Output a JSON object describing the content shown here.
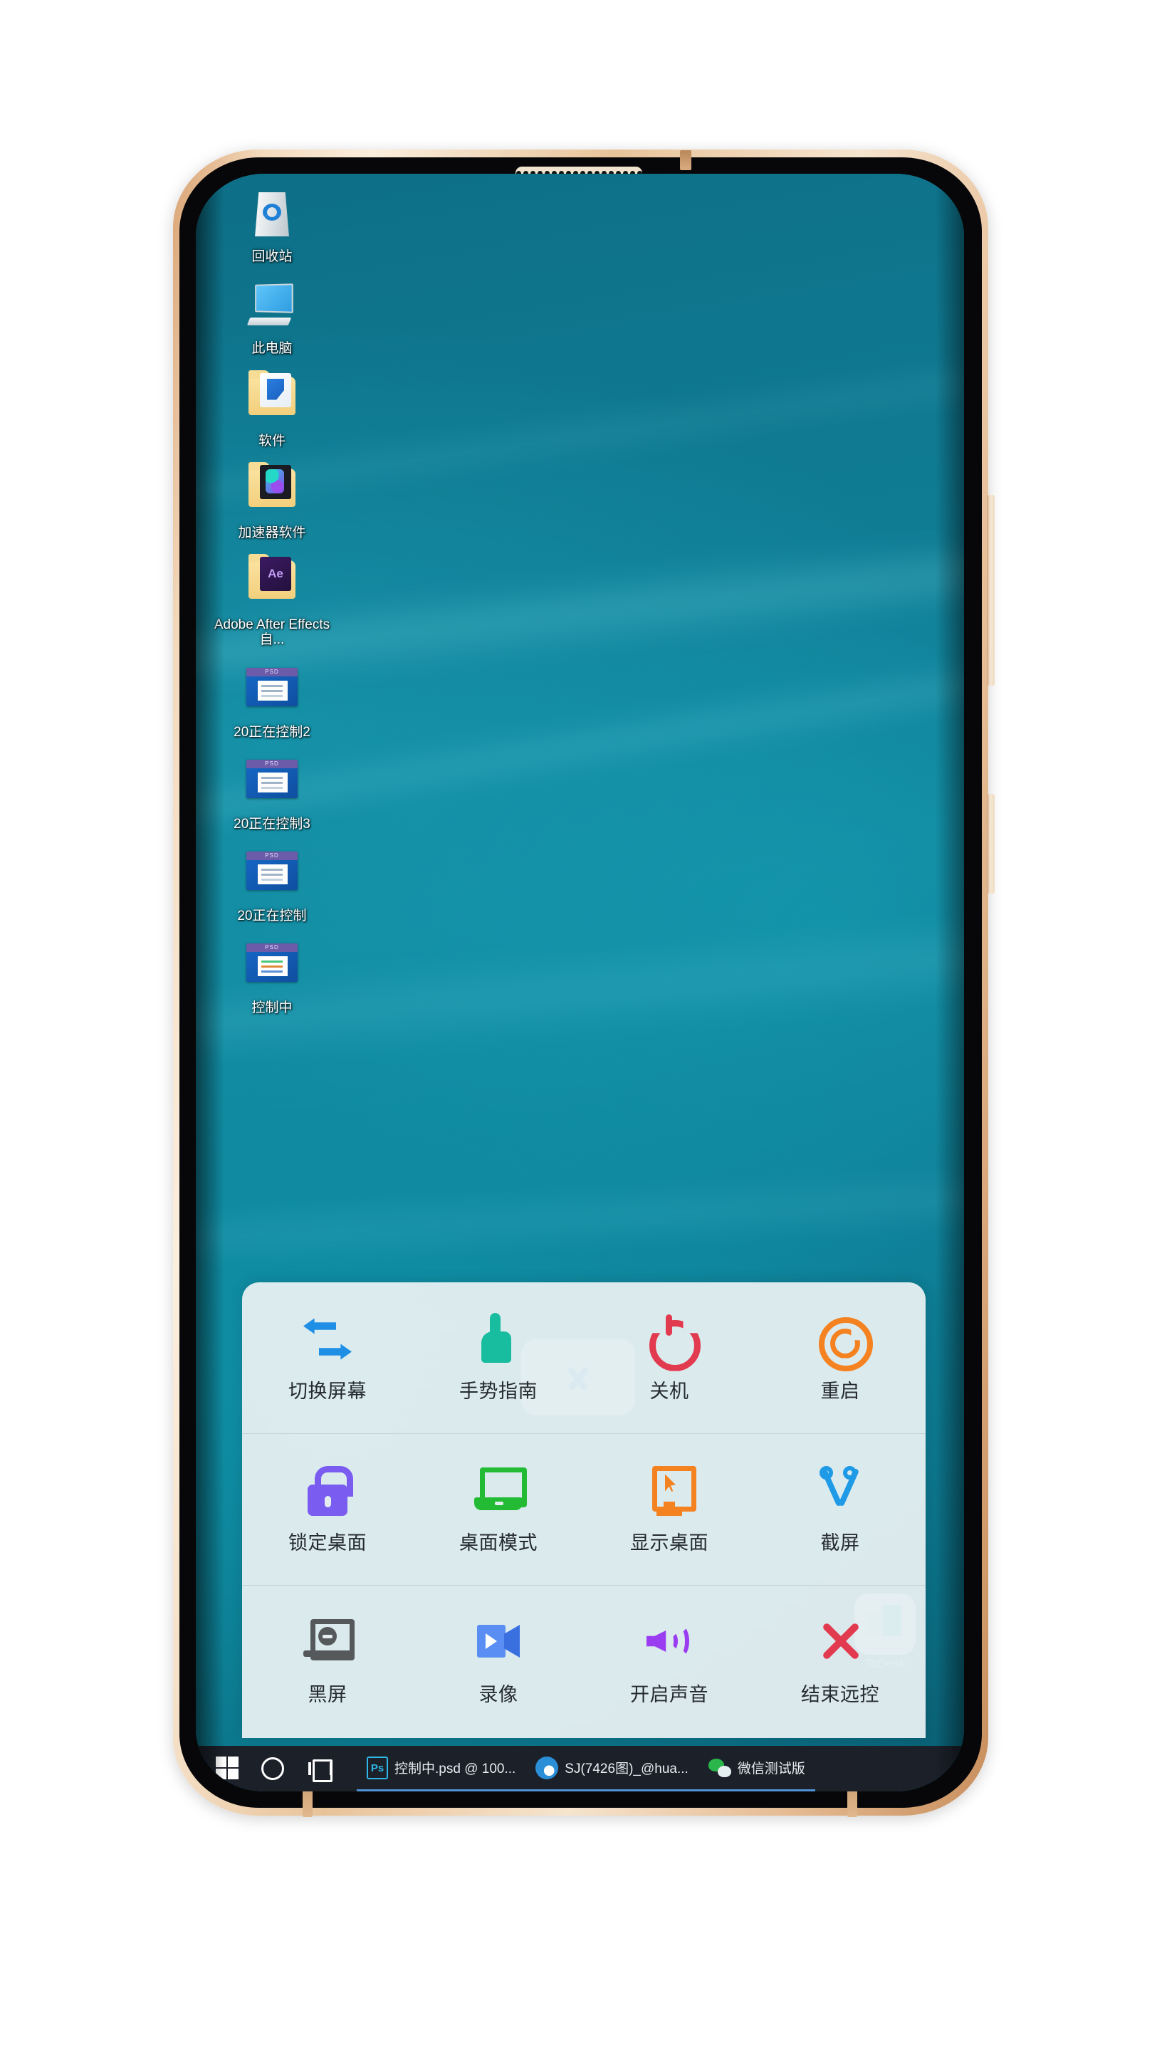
{
  "device": {
    "name": "smartphone-mockup",
    "frame_color": "#e8c39a",
    "screen_bg": "#0f7a92"
  },
  "desktop": {
    "icons": [
      {
        "label": "回收站",
        "icon": "recycle-bin-icon"
      },
      {
        "label": "此电脑",
        "icon": "this-pc-icon"
      },
      {
        "label": "软件",
        "icon": "folder-icon"
      },
      {
        "label": "加速器软件",
        "icon": "folder-icon"
      },
      {
        "label": "Adobe After Effects 自...",
        "icon": "folder-icon"
      },
      {
        "label": "20正在控制2",
        "icon": "psd-file-icon"
      },
      {
        "label": "20正在控制3",
        "icon": "psd-file-icon"
      },
      {
        "label": "20正在控制",
        "icon": "psd-file-icon"
      },
      {
        "label": "控制中",
        "icon": "psd-file-icon"
      }
    ]
  },
  "collapse_button": {
    "name": "collapse-toolbar-button",
    "icon": "chevron-down-icon",
    "color": "#1677ff"
  },
  "toolbar": {
    "rows": [
      [
        {
          "label": "切换屏幕",
          "icon": "switch-screen-icon",
          "color": "#1f8fe6"
        },
        {
          "label": "手势指南",
          "icon": "gesture-guide-icon",
          "color": "#18bda0"
        },
        {
          "label": "关机",
          "icon": "power-off-icon",
          "color": "#e23a4e"
        },
        {
          "label": "重启",
          "icon": "restart-icon",
          "color": "#f58220"
        }
      ],
      [
        {
          "label": "锁定桌面",
          "icon": "lock-desktop-icon",
          "color": "#7b5cf0"
        },
        {
          "label": "桌面模式",
          "icon": "desktop-mode-icon",
          "color": "#22bb33"
        },
        {
          "label": "显示桌面",
          "icon": "show-desktop-icon",
          "color": "#f58220"
        },
        {
          "label": "截屏",
          "icon": "screenshot-icon",
          "color": "#1f9ae6"
        }
      ],
      [
        {
          "label": "黑屏",
          "icon": "black-screen-icon",
          "color": "#55595c"
        },
        {
          "label": "录像",
          "icon": "record-video-icon",
          "color": "#5a8ef2"
        },
        {
          "label": "开启声音",
          "icon": "enable-sound-icon",
          "color": "#9a3df0"
        },
        {
          "label": "结束远控",
          "icon": "end-remote-icon",
          "color": "#e23a4e"
        }
      ]
    ]
  },
  "floating_widget": {
    "label": "ToDesk",
    "icon": "todesk-logo-icon"
  },
  "taskbar": {
    "start_icon": "windows-start-icon",
    "search_icon": "search-icon",
    "taskview_icon": "task-view-icon",
    "tasks": [
      {
        "label": "控制中.psd @ 100...",
        "icon": "photoshop-icon"
      },
      {
        "label": "SJ(7426图)_@hua...",
        "icon": "app-circle-icon"
      },
      {
        "label": "微信测试版",
        "icon": "wechat-icon"
      }
    ]
  }
}
